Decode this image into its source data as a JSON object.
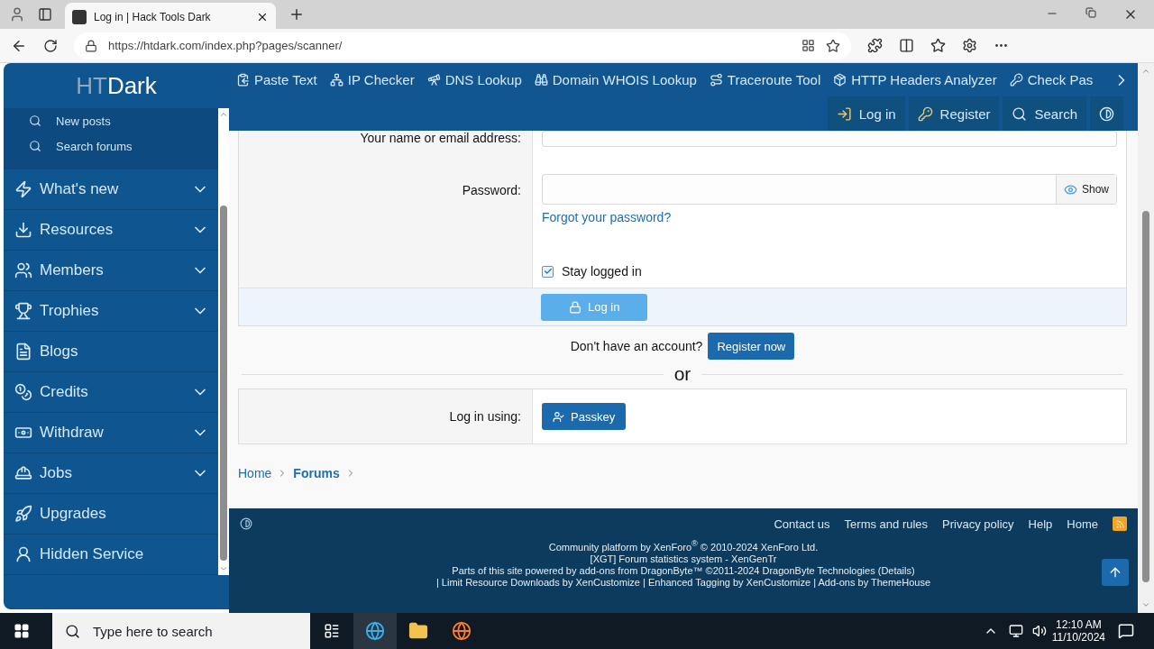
{
  "browser": {
    "tab_title": "Log in | Hack Tools Dark",
    "url": "https://htdark.com/index.php?pages/scanner/"
  },
  "site": {
    "logo": {
      "light": "HT",
      "bold": "Dark"
    },
    "tool_nav": [
      "Paste Text",
      "IP Checker",
      "DNS Lookup",
      "Domain WHOIS Lookup",
      "Traceroute Tool",
      "HTTP Headers Analyzer",
      "Check Pas"
    ],
    "header_actions": [
      "Log in",
      "Register",
      "Search"
    ]
  },
  "sidebar": {
    "subitems": [
      "New posts",
      "Search forums"
    ],
    "items": [
      {
        "label": "What's new",
        "expandable": true
      },
      {
        "label": "Resources",
        "expandable": true
      },
      {
        "label": "Members",
        "expandable": true
      },
      {
        "label": "Trophies",
        "expandable": true
      },
      {
        "label": "Blogs",
        "expandable": false
      },
      {
        "label": "Credits",
        "expandable": true
      },
      {
        "label": "Withdraw",
        "expandable": true
      },
      {
        "label": "Jobs",
        "expandable": true
      },
      {
        "label": "Upgrades",
        "expandable": false
      },
      {
        "label": "Hidden Service",
        "expandable": false
      }
    ]
  },
  "form": {
    "fields": [
      {
        "label": "Your name or email address:"
      },
      {
        "label": "Password:",
        "toggle": "Show",
        "link": "Forgot your password?"
      }
    ],
    "stay_logged_in": {
      "label": "Stay logged in",
      "checked": true
    },
    "submit": "Log in"
  },
  "register": {
    "prompt": "Don't have an account?",
    "button": "Register now"
  },
  "divider": "or",
  "alt_login": {
    "label": "Log in using:",
    "button": "Passkey"
  },
  "breadcrumbs": [
    {
      "label": "Home",
      "current": false
    },
    {
      "label": "Forums",
      "current": true
    }
  ],
  "footer": {
    "links": [
      "Contact us",
      "Terms and rules",
      "Privacy policy",
      "Help",
      "Home"
    ],
    "lines": [
      "Community platform by XenForo$^{®}$ © 2010-2024 XenForo Ltd.",
      "[XGT] Forum statistics system - XenGenTr",
      "Parts of this site powered by add-ons from DragonByte™ ©2011-2024 DragonByte Technologies (Details)",
      "| Limit Resource Downloads by XenCustomize | Enhanced Tagging by XenCustomize | Add-ons by ThemeHouse"
    ]
  },
  "taskbar": {
    "search_placeholder": "Type here to search",
    "time": "12:10 AM",
    "date": "11/10/2024"
  }
}
